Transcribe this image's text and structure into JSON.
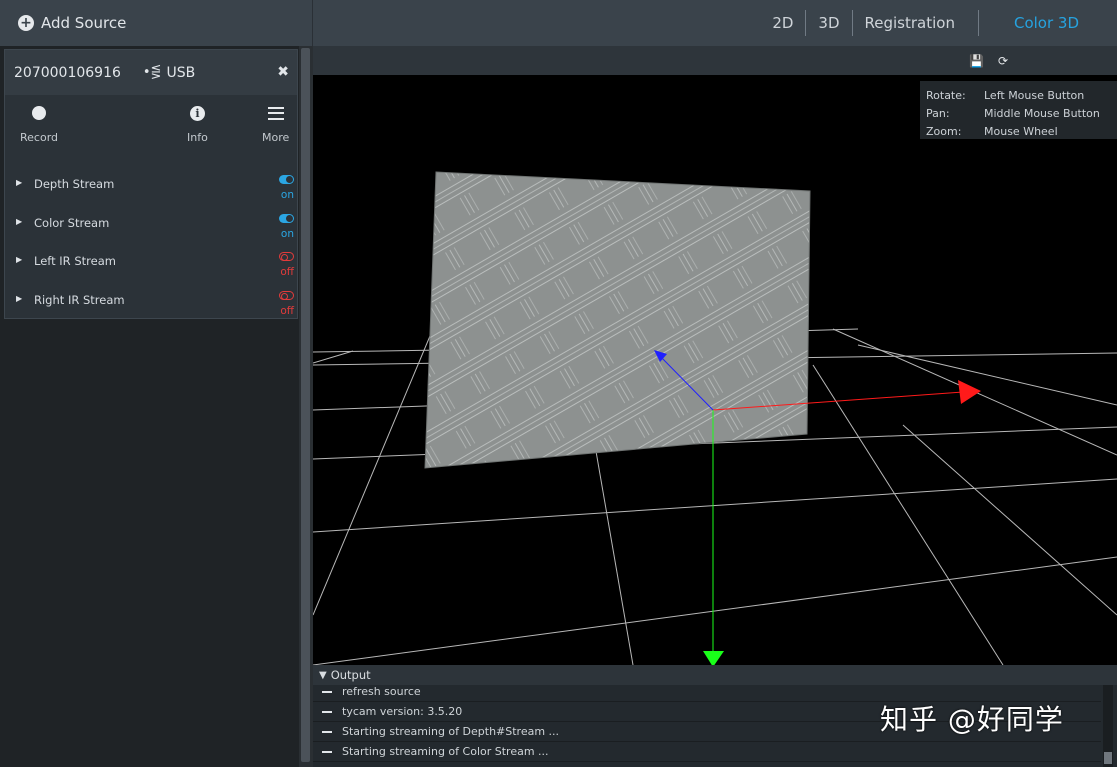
{
  "header": {
    "add_source_label": "Add Source",
    "tabs": [
      {
        "label": "2D",
        "active": false
      },
      {
        "label": "3D",
        "active": false
      },
      {
        "label": "Registration",
        "active": false
      },
      {
        "label": "Color 3D",
        "active": true
      }
    ]
  },
  "device": {
    "id": "207000106916",
    "connection": "USB",
    "actions": {
      "record": "Record",
      "info": "Info",
      "more": "More"
    },
    "streams": [
      {
        "name": "Depth Stream",
        "state": "on"
      },
      {
        "name": "Color Stream",
        "state": "on"
      },
      {
        "name": "Left IR Stream",
        "state": "off"
      },
      {
        "name": "Right IR Stream",
        "state": "off"
      }
    ]
  },
  "viewport": {
    "toolbar_icons": [
      "save-icon",
      "refresh-icon"
    ],
    "controls": [
      {
        "key": "Rotate:",
        "value": "Left Mouse Button"
      },
      {
        "key": "Pan:",
        "value": "Middle Mouse Button"
      },
      {
        "key": "Zoom:",
        "value": "Mouse Wheel"
      }
    ],
    "axis_colors": {
      "x": "#ff1a1a",
      "y": "#1aff1a",
      "z": "#2020ff"
    }
  },
  "output": {
    "title": "Output",
    "lines": [
      "refresh source",
      "tycam version: 3.5.20",
      "Starting streaming of Depth#Stream ...",
      "Starting streaming of Color Stream ..."
    ]
  },
  "watermark": "知乎 @好同学",
  "colors": {
    "accent": "#26a3e0",
    "on": "#2ba6e3",
    "off": "#e23b3b"
  }
}
